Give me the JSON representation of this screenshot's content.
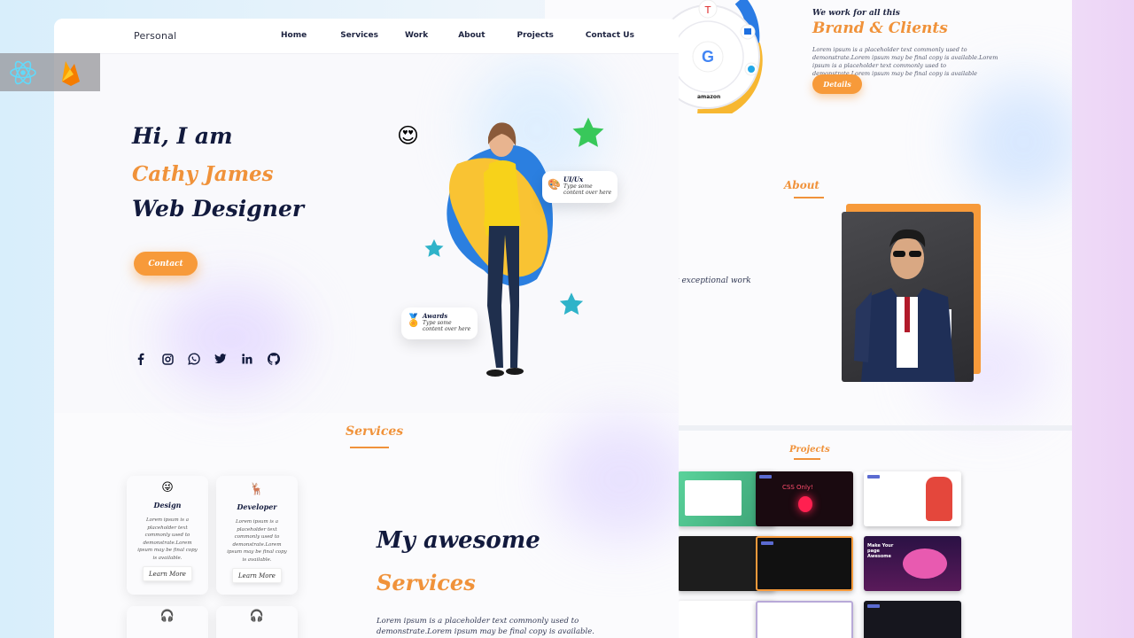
{
  "colors": {
    "accent": "#f0923a",
    "dark": "#121a3d",
    "button": "#f79a3a"
  },
  "nav": {
    "logo": "Personal",
    "items": [
      "Home",
      "Services",
      "Work",
      "About",
      "Projects",
      "Contact Us"
    ]
  },
  "hero": {
    "greeting": "Hi, I am",
    "name": "Cathy James",
    "role": "Web Designer",
    "contact_label": "Contact",
    "socials": [
      "facebook-icon",
      "instagram-icon",
      "whatsapp-icon",
      "twitter-icon",
      "linkedin-icon",
      "github-icon"
    ],
    "badge_ui": {
      "title": "UI/Ux",
      "text": "Type some content over here"
    },
    "badge_awards": {
      "title": "Awards",
      "text": "Type some content over here"
    }
  },
  "services": {
    "heading": "Services",
    "cards": [
      {
        "title": "Design",
        "icon": "winking-emoji-icon",
        "desc": "Lorem ipsum is a placeholder text commonly used to demonstrate.Lorem ipsum may be final copy is available.",
        "button": "Learn More"
      },
      {
        "title": "Developer",
        "icon": "reindeer-emoji-icon",
        "desc": "Lorem ipsum is a placeholder text commonly used to demonstrate.Lorem ipsum may be final copy is available.",
        "button": "Learn More"
      }
    ],
    "title_line1": "My awesome",
    "title_line2": "Services",
    "description": "Lorem ipsum is a placeholder text commonly used to demonstrate.Lorem ipsum may be final copy is available."
  },
  "right_page": {
    "brand_tag": "We work for all this",
    "brand_title": "Brand & Clients",
    "brand_desc": "Lorem ipsum is a placeholder text commonly used to demonstrate.Lorem ipsum may be final copy is available.Lorem ipsum is a placeholder text commonly used to demonstrate.Lorem ipsum may be final copy is available",
    "brand_button": "Details",
    "about_heading": "About",
    "about_text": "t exceptional work",
    "projects_heading": "Projects",
    "orbit_label": "amazon",
    "project_texts": [
      "CSS Only!",
      "Make Your page Awesome"
    ]
  },
  "tech_icons": [
    "react-icon",
    "firebase-icon"
  ]
}
